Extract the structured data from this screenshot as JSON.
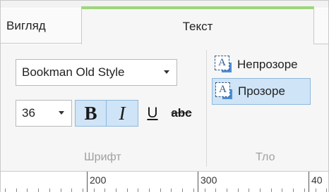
{
  "tabs": {
    "view": "Вигляд",
    "text": "Текст"
  },
  "font_group": {
    "font_family": "Bookman Old Style",
    "font_size": "36",
    "bold": "B",
    "italic": "I",
    "underline": "U",
    "strike": "abc",
    "label": "Шрифт"
  },
  "bg_group": {
    "opaque": "Непрозоре",
    "transparent": "Прозоре",
    "glyph_letter": "A",
    "label": "Тло"
  },
  "ruler": {
    "labels": [
      "200",
      "300",
      "40"
    ]
  },
  "colors": {
    "accent_tab": "#9cd67a",
    "selected_fill": "#cfe4f7"
  }
}
